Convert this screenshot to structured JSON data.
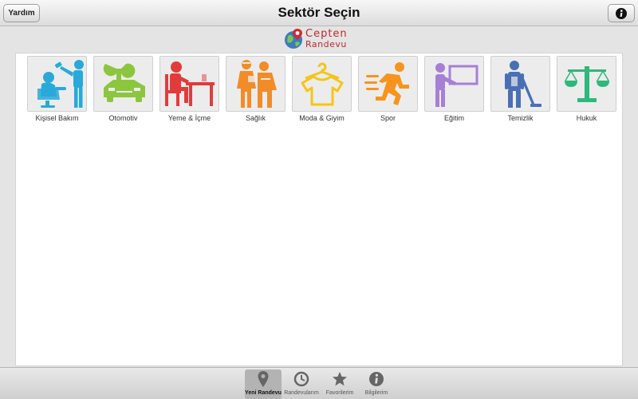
{
  "header": {
    "title": "Sektör Seçin",
    "help_label": "Yardım",
    "info_icon": "info-icon"
  },
  "logo": {
    "line1": "Cepten",
    "line2": "Randevu",
    "icon": "globe-pin-icon"
  },
  "sectors": [
    {
      "label": "Kişisel Bakım",
      "icon": "hairdresser-icon",
      "color": "#29a9d9"
    },
    {
      "label": "Otomotiv",
      "icon": "car-wrench-icon",
      "color": "#8cc63f"
    },
    {
      "label": "Yeme & İçme",
      "icon": "dining-icon",
      "color": "#e23b3b"
    },
    {
      "label": "Sağlık",
      "icon": "injured-people-icon",
      "color": "#f28c28"
    },
    {
      "label": "Moda & Giyim",
      "icon": "shirt-hanger-icon",
      "color": "#f5c518"
    },
    {
      "label": "Spor",
      "icon": "runner-icon",
      "color": "#f7941d"
    },
    {
      "label": "Eğitim",
      "icon": "teacher-board-icon",
      "color": "#a67fd6"
    },
    {
      "label": "Temizlik",
      "icon": "cleaner-icon",
      "color": "#4a6fb5"
    },
    {
      "label": "Hukuk",
      "icon": "scales-icon",
      "color": "#2eb87a"
    }
  ],
  "tabs": [
    {
      "label": "Yeni Randevu",
      "icon": "location-pin-icon",
      "active": true
    },
    {
      "label": "Randevularım",
      "icon": "clock-icon",
      "active": false
    },
    {
      "label": "Favorilerim",
      "icon": "star-icon",
      "active": false
    },
    {
      "label": "Bilgilerim",
      "icon": "info-icon",
      "active": false
    }
  ]
}
